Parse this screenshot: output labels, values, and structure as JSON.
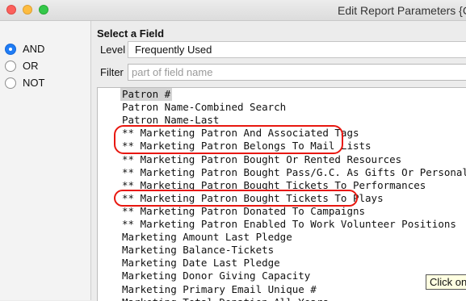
{
  "window": {
    "title": "Edit Report Parameters {Co"
  },
  "logic": {
    "options": [
      {
        "label": "AND",
        "checked": true
      },
      {
        "label": "OR",
        "checked": false
      },
      {
        "label": "NOT",
        "checked": false
      }
    ]
  },
  "field_panel": {
    "title": "Select a Field",
    "level_label": "Level",
    "level_value": "Frequently Used",
    "filter_label": "Filter",
    "filter_placeholder": "part of field name"
  },
  "fields": {
    "items": [
      "Patron #",
      "Patron Name-Combined Search",
      "Patron Name-Last",
      "** Marketing Patron And Associated Tags",
      "** Marketing Patron Belongs To Mail Lists",
      "** Marketing Patron Bought Or Rented Resources",
      "** Marketing Patron Bought Pass/G.C. As Gifts Or Personal Use",
      "** Marketing Patron Bought Tickets To Performances",
      "** Marketing Patron Bought Tickets To Plays",
      "** Marketing Patron Donated To Campaigns",
      "** Marketing Patron Enabled To Work Volunteer Positions",
      "Marketing Amount Last Pledge",
      "Marketing Balance-Tickets",
      "Marketing Date Last Pledge",
      "Marketing Donor Giving Capacity",
      "Marketing Primary Email Unique #",
      "Marketing Total Donation All Years"
    ],
    "selected_index": 0,
    "highlight_color": "#e8170f"
  },
  "tooltip": {
    "text": "Click on"
  }
}
